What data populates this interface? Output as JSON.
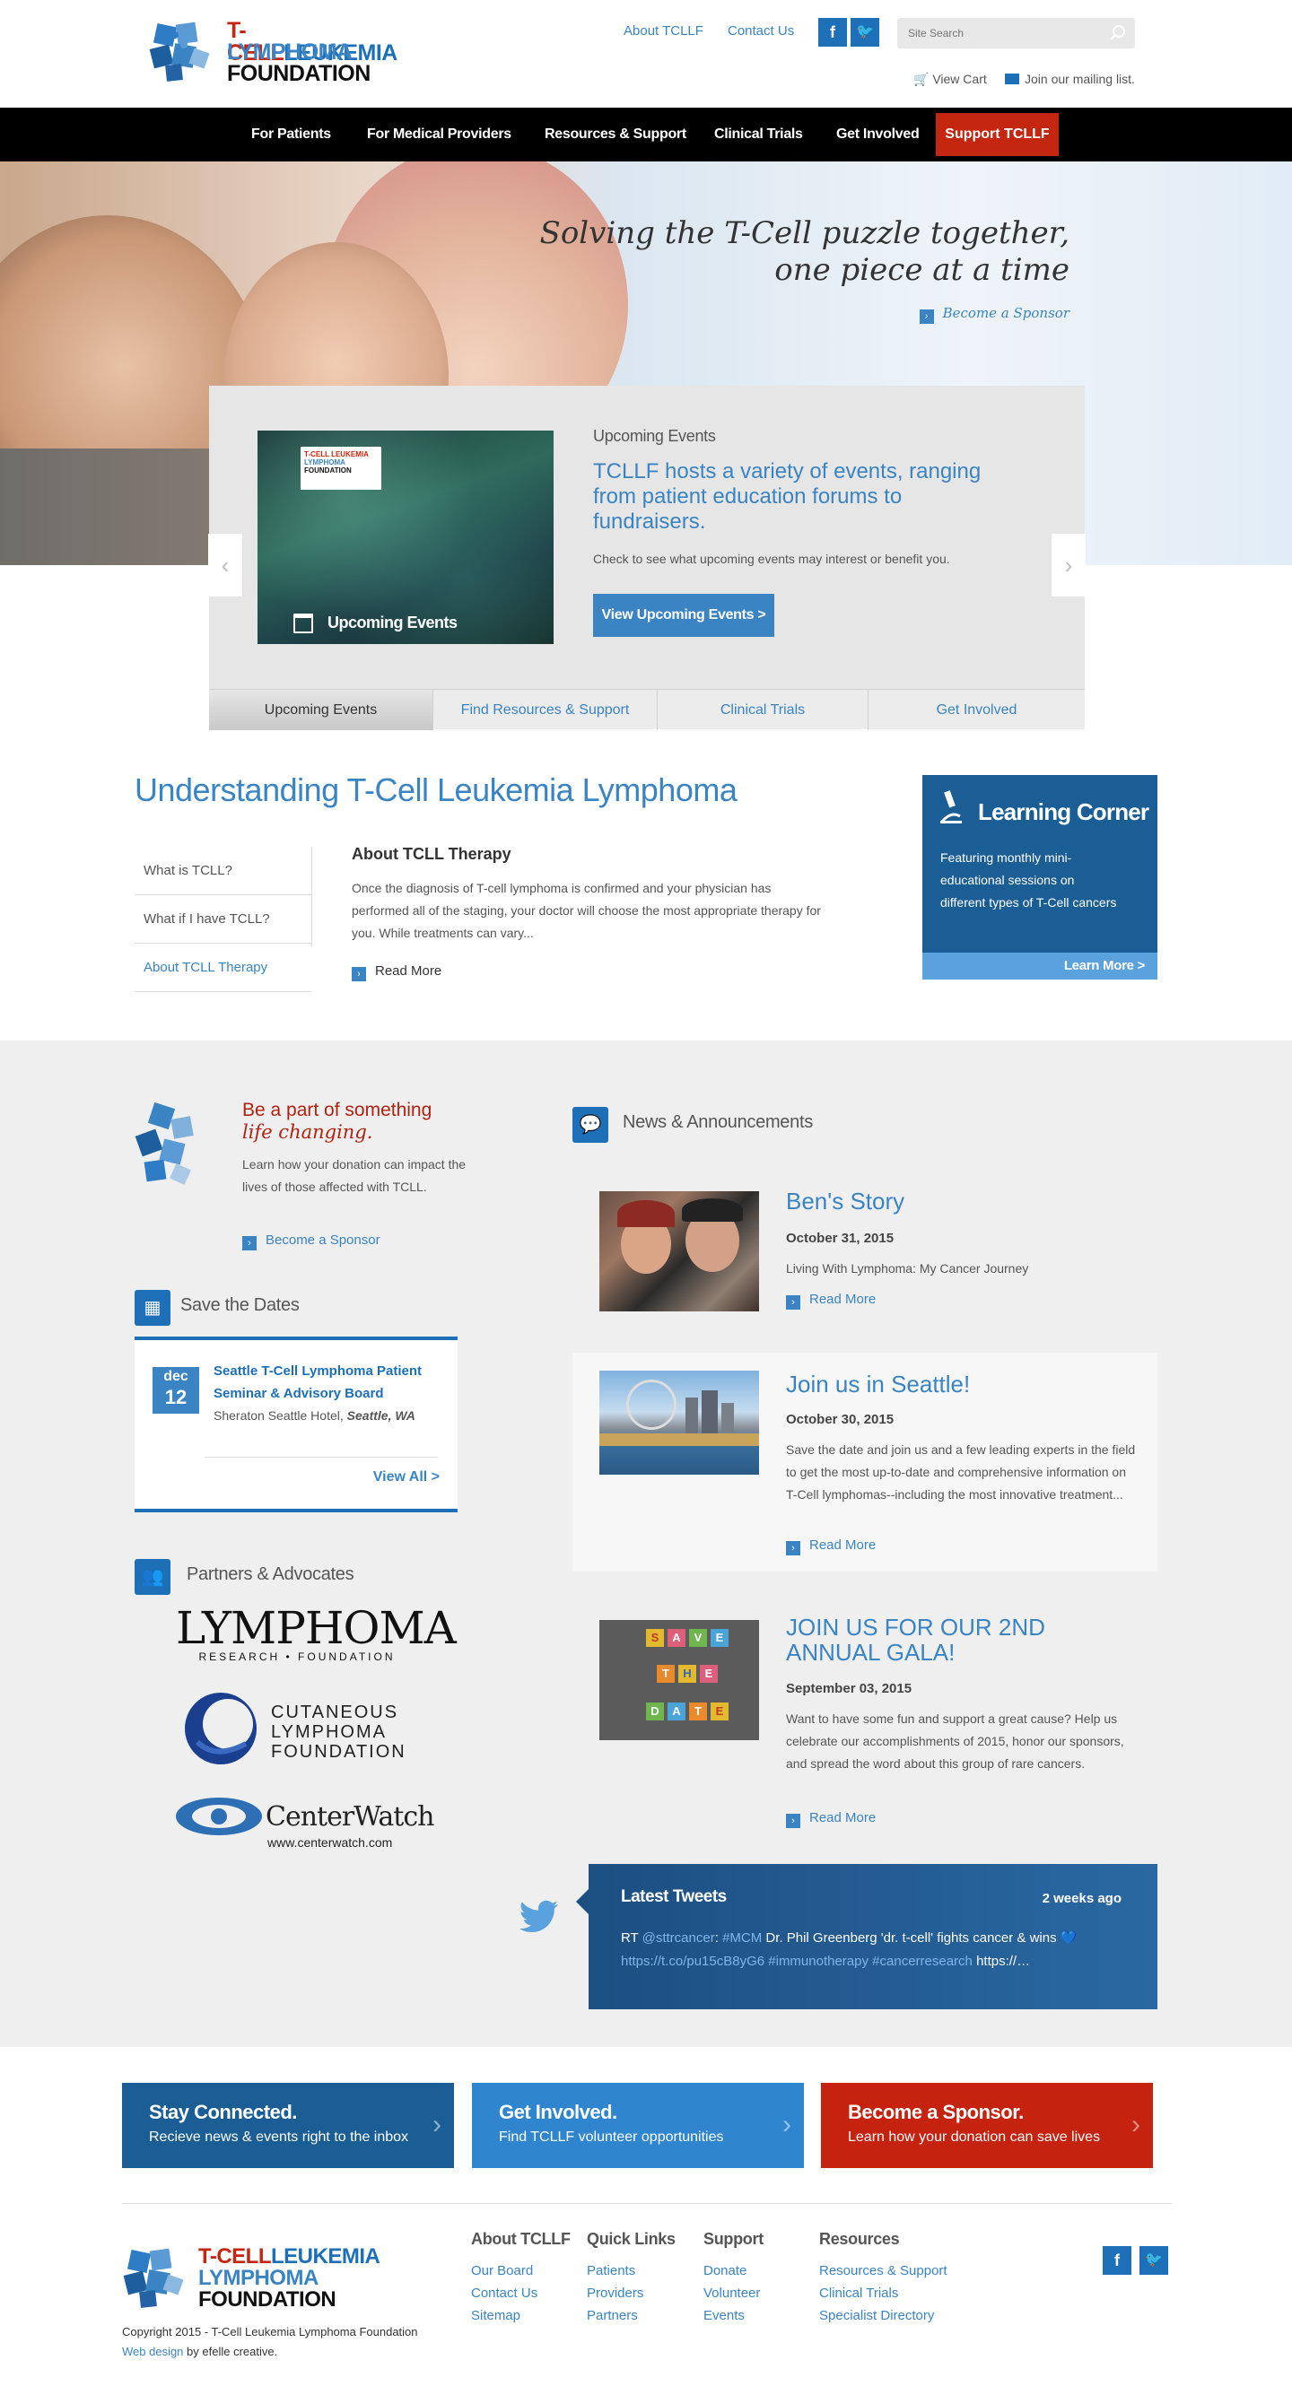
{
  "header": {
    "logo": {
      "line1": "T-CELL",
      "line1b": "LEUKEMIA",
      "line2": "LYMPHOMA",
      "line3": "FOUNDATION"
    },
    "links": [
      "About TCLLF",
      "Contact Us"
    ],
    "search_placeholder": "Site Search",
    "view_cart": "View Cart",
    "mailing_list": "Join our mailing list."
  },
  "nav": {
    "items": [
      "For Patients",
      "For Medical Providers",
      "Resources & Support",
      "Clinical Trials",
      "Get Involved"
    ],
    "support": "Support TCLLF"
  },
  "hero": {
    "tagline_1": "Solving the T-Cell puzzle together,",
    "tagline_2": "one piece at a time",
    "sponsor_link": "Become a Sponsor"
  },
  "slider": {
    "label": "Upcoming Events",
    "headline": "TCLLF hosts a variety of events, ranging from patient education forums to fundraisers.",
    "text": "Check to see what upcoming events may interest or benefit you.",
    "button": "View Upcoming Events >",
    "image_caption": "Upcoming Events",
    "image_logo_1": "T-CELL LEUKEMIA",
    "image_logo_2": "LYMPHOMA",
    "image_logo_3": "FOUNDATION",
    "tabs": [
      "Upcoming Events",
      "Find Resources & Support",
      "Clinical Trials",
      "Get Involved"
    ]
  },
  "understanding": {
    "title": "Understanding T-Cell Leukemia Lymphoma",
    "side_items": [
      "What is TCLL?",
      "What if I have TCLL?",
      "About TCLL Therapy"
    ],
    "article_title": "About TCLL Therapy",
    "article_text": "Once the diagnosis of T-cell lymphoma is confirmed and your physician has performed all of the staging, your doctor will choose the most appropriate therapy for you. While treatments can vary...",
    "read_more": "Read More"
  },
  "learning_corner": {
    "title": "Learning Corner",
    "text": "Featuring monthly mini-educational sessions on different types of T-Cell cancers",
    "link": "Learn More >"
  },
  "be_a_part": {
    "title_1": "Be a part of something",
    "title_2": "life changing.",
    "text": "Learn how your donation can impact the lives of those affected with TCLL.",
    "link": "Become a Sponsor"
  },
  "save_the_dates": {
    "title": "Save the Dates",
    "event_month": "dec",
    "event_day": "12",
    "event_title": "Seattle T-Cell Lymphoma Patient Seminar & Advisory Board",
    "event_place": "Sheraton Seattle Hotel,",
    "event_city": "Seattle, WA",
    "view_all": "View All >"
  },
  "partners": {
    "title": "Partners & Advocates",
    "lrf_1": "LYMPHOMA",
    "lrf_2": "RESEARCH • FOUNDATION",
    "clf_1": "CUTANEOUS",
    "clf_2": "LYMPHOMA",
    "clf_3": "FOUNDATION",
    "cw_name": "CenterWatch",
    "cw_url": "www.centerwatch.com"
  },
  "news": {
    "title": "News & Announcements",
    "items": [
      {
        "title": "Ben's Story",
        "date": "October 31, 2015",
        "text": "Living With Lymphoma: My Cancer Journey",
        "more": "Read More"
      },
      {
        "title": "Join us in Seattle!",
        "date": "October 30, 2015",
        "text": "Save the date and join us and a few leading experts in the field to get the most up-to-date and comprehensive information on T-Cell lymphomas--including the most innovative treatment...",
        "more": "Read More"
      },
      {
        "title": "JOIN US FOR OUR 2ND ANNUAL GALA!",
        "date": "September 03, 2015",
        "text": "Want to have some fun and support a great cause? Help us celebrate our accomplishments of 2015, honor our sponsors, and spread the word about this group of rare cancers.",
        "more": "Read More"
      }
    ],
    "save_tiles": [
      "S",
      "A",
      "V",
      "E",
      "T",
      "H",
      "E",
      "D",
      "A",
      "T",
      "E"
    ]
  },
  "tweets": {
    "title": "Latest Tweets",
    "time": "2 weeks ago",
    "text_1": "RT ",
    "handle": "@sttrcancer",
    "text_2": ": ",
    "hashtag1": "#MCM",
    "text_3": " Dr. Phil Greenberg 'dr. t-cell' fights cancer & wins 💙",
    "link": "https://t.co/pu15cB8yG6",
    "hashtag2": "#immunotherapy",
    "hashtag3": "#cancerresearch",
    "text_4": " https://…"
  },
  "cta": [
    {
      "title": "Stay Connected.",
      "sub": "Recieve news & events right to the inbox",
      "color": "#1b5e96"
    },
    {
      "title": "Get Involved.",
      "sub": "Find TCLLF volunteer opportunities",
      "color": "#2f86cf"
    },
    {
      "title": "Become a Sponsor.",
      "sub": "Learn how your donation can save lives",
      "color": "#c5220f"
    }
  ],
  "footer": {
    "cols": [
      {
        "title": "About TCLLF",
        "links": [
          "Our Board",
          "Contact Us",
          "Sitemap"
        ]
      },
      {
        "title": "Quick Links",
        "links": [
          "Patients",
          "Providers",
          "Partners"
        ]
      },
      {
        "title": "Support",
        "links": [
          "Donate",
          "Volunteer",
          "Events"
        ]
      },
      {
        "title": "Resources",
        "links": [
          "Resources & Support",
          "Clinical Trials",
          "Specialist Directory"
        ]
      }
    ],
    "copyright": "Copyright 2015 - T-Cell Leukemia Lymphoma Foundation",
    "webdesign": "Web design",
    "by": " by efelle creative."
  }
}
